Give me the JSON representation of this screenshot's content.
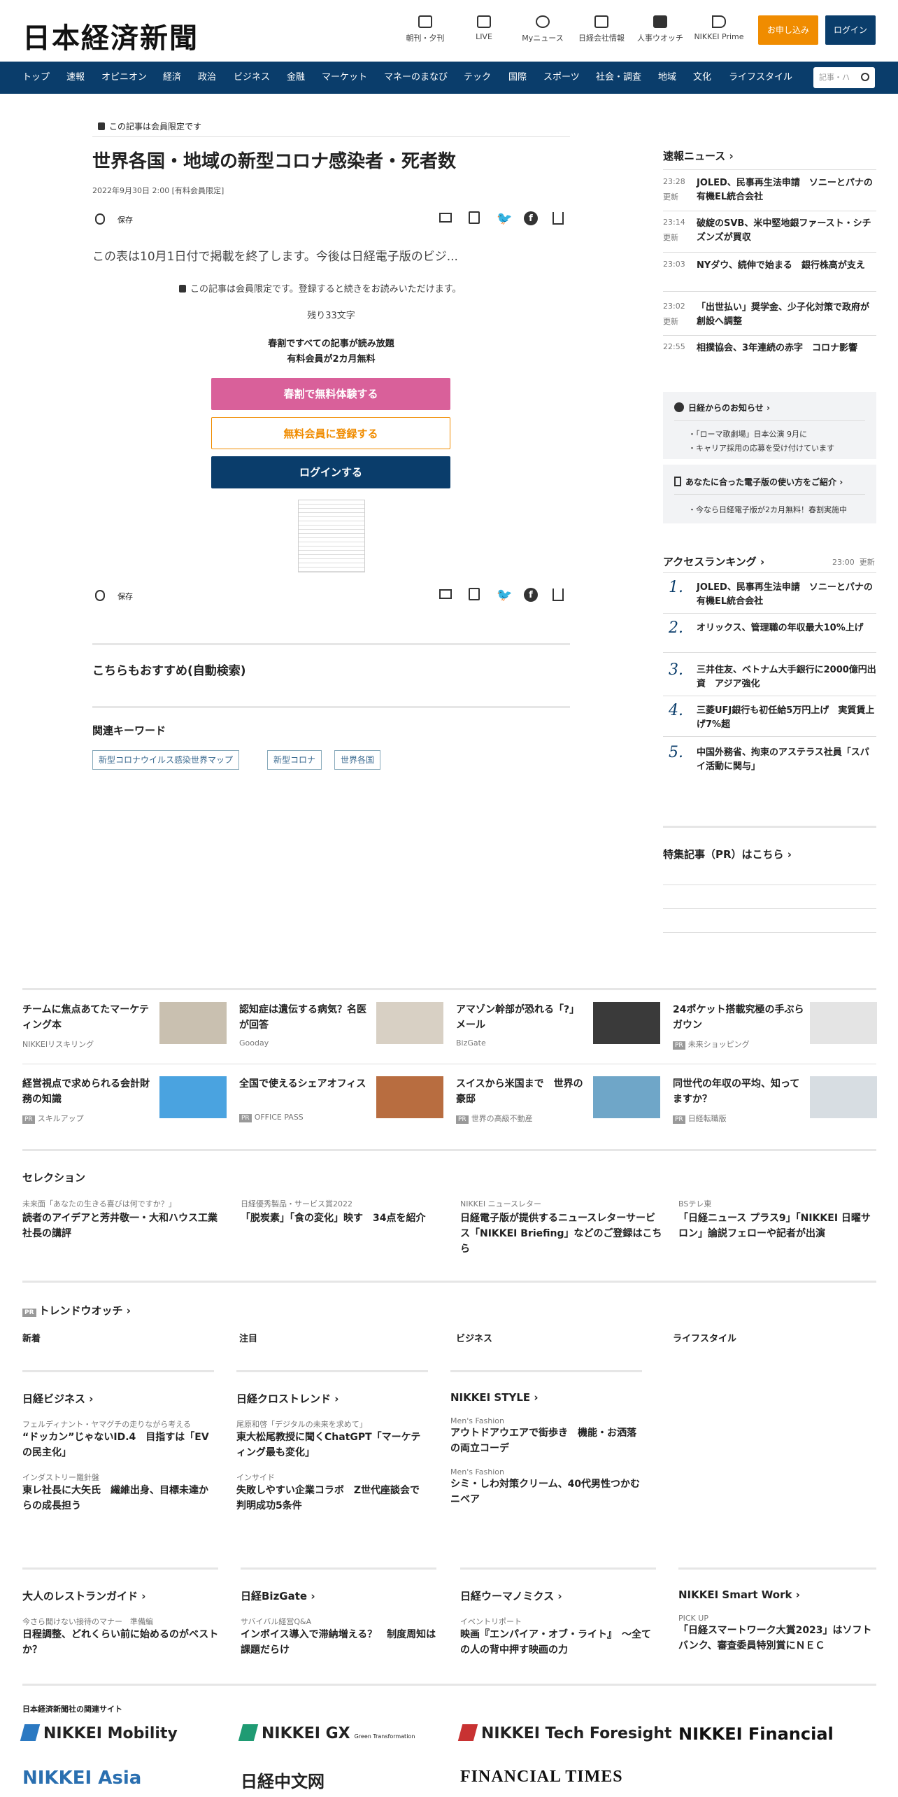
{
  "header": {
    "logo": "日本経済新聞",
    "icons": [
      {
        "label": "朝刊・夕刊",
        "icon": "newspaper-icon"
      },
      {
        "label": "LIVE",
        "icon": "video-icon"
      },
      {
        "label": "Myニュース",
        "icon": "user-icon"
      },
      {
        "label": "日経会社情報",
        "icon": "chart-icon"
      },
      {
        "label": "人事ウオッチ",
        "icon": "search-icon"
      },
      {
        "label": "NIKKEI Prime",
        "icon": "prime-icon"
      }
    ],
    "subscribe": "お申し込み",
    "login": "ログイン"
  },
  "nav": {
    "items": [
      "トップ",
      "速報",
      "オピニオン",
      "経済",
      "政治",
      "ビジネス",
      "金融",
      "マーケット",
      "マネーのまなび",
      "テック",
      "国際",
      "スポーツ",
      "社会・調査",
      "地域",
      "文化",
      "ライフスタイル"
    ],
    "search_placeholder": "記事・ハ"
  },
  "article": {
    "member_only": "この記事は会員限定です",
    "title": "世界各国・地域の新型コロナ感染者・死者数",
    "date": "2022年9月30日 2:00 [有料会員限定]",
    "save": "保存",
    "lead": "この表は10月1日付で掲載を終了します。今後は日経電子版のビジ...",
    "paywall_note": "この記事は会員限定です。登録すると続きをお読みいただけます。",
    "remaining": "残り33文字",
    "promo1": "春割ですべての記事が読み放題",
    "promo2": "有料会員が2カ月無料",
    "cta_trial": "春割で無料体験する",
    "cta_free": "無料会員に登録する",
    "cta_login": "ログインする",
    "recommend": "こちらもおすすめ(自動検索)",
    "keywords_title": "関連キーワード",
    "keywords": [
      "新型コロナウイルス感染世界マップ",
      "新型コロナ",
      "世界各国"
    ]
  },
  "sidebar": {
    "breaking_title": "速報ニュース",
    "breaking": [
      {
        "time": "23:28",
        "upd": "更新",
        "text": "JOLED、民事再生法申請　ソニーとパナの有機EL統合会社"
      },
      {
        "time": "23:14",
        "upd": "更新",
        "text": "破綻のSVB、米中堅地銀ファースト・シチズンズが買収"
      },
      {
        "time": "23:03",
        "upd": "",
        "text": "NYダウ、続伸で始まる　銀行株高が支え"
      },
      {
        "time": "23:02",
        "upd": "更新",
        "text": "「出世払い」奨学金、少子化対策で政府が創設へ調整"
      },
      {
        "time": "22:55",
        "upd": "",
        "text": "相撲協会、3年連続の赤字　コロナ影響"
      }
    ],
    "notice_title": "日経からのお知らせ",
    "notices": [
      "「ローマ歌劇場」日本公演 9月に",
      "キャリア採用の応募を受け付けています"
    ],
    "guide_title": "あなたに合った電子版の使い方をご紹介",
    "guide_items": [
      "今なら日経電子版が2カ月無料！春割実施中"
    ],
    "ranking_title": "アクセスランキング",
    "ranking_time": "23:00",
    "ranking_upd": "更新",
    "ranking": [
      {
        "n": "1.",
        "text": "JOLED、民事再生法申請　ソニーとパナの有機EL統合会社"
      },
      {
        "n": "2.",
        "text": "オリックス、管理職の年収最大10%上げ"
      },
      {
        "n": "3.",
        "text": "三井住友、ベトナム大手銀行に2000億円出資　アジア強化"
      },
      {
        "n": "4.",
        "text": "三菱UFJ銀行も初任給5万円上げ　実質賃上げ7%超"
      },
      {
        "n": "5.",
        "text": "中国外務省、拘束のアステラス社員「スパイ活動に関与」"
      }
    ],
    "pr_title": "特集記事（PR）はこちら"
  },
  "promos": [
    {
      "title": "チームに焦点あてたマーケティング本",
      "src": "NIKKEIリスキリング",
      "pr": false
    },
    {
      "title": "認知症は遺伝する病気？名医が回答",
      "src": "Gooday",
      "pr": false
    },
    {
      "title": "アマゾン幹部が恐れる「?」メール",
      "src": "BizGate",
      "pr": false
    },
    {
      "title": "24ポケット搭載究極の手ぶらガウン",
      "src": "未来ショッピング",
      "pr": true
    },
    {
      "title": "経営視点で求められる会計財務の知識",
      "src": "スキルアップ",
      "pr": true
    },
    {
      "title": "全国で使えるシェアオフィス",
      "src": "OFFICE PASS",
      "pr": true
    },
    {
      "title": "スイスから米国まで　世界の豪邸",
      "src": "世界の高級不動産",
      "pr": true
    },
    {
      "title": "同世代の年収の平均、知ってますか？",
      "src": "日経転職版",
      "pr": true
    }
  ],
  "selection": {
    "title": "セレクション",
    "items": [
      {
        "label": "未来面「あなたの生きる喜びは何ですか？」",
        "text": "読者のアイデアと芳井敬一・大和ハウス工業社長の講評"
      },
      {
        "label": "日経優秀製品・サービス賞2022",
        "text": "「脱炭素」「食の変化」映す　34点を紹介"
      },
      {
        "label": "NIKKEI ニュースレター",
        "text": "日経電子版が提供するニュースレターサービス「NIKKEI Briefing」などのご登録はこちら"
      },
      {
        "label": "BSテレ東",
        "text": "「日経ニュース プラス9」「NIKKEI 日曜サロン」論説フェローや記者が出演"
      }
    ]
  },
  "trend": {
    "title": "トレンドウオッチ",
    "tabs": [
      "新着",
      "注目",
      "ビジネス",
      "ライフスタイル"
    ],
    "cols": [
      {
        "head": "日経ビジネス",
        "items": [
          {
            "label": "フェルディナント・ヤマグチの走りながら考える",
            "text": "“ドッカン”じゃないID.4　目指すは「EVの民主化」"
          },
          {
            "label": "インダストリー羅針盤",
            "text": "東レ社長に大矢氏　繊維出身、目標未達からの成長担う"
          }
        ]
      },
      {
        "head": "日経クロストレンド",
        "items": [
          {
            "label": "尾原和啓「デジタルの未来を求めて」",
            "text": "東大松尾教授に聞くChatGPT「マーケティング最も変化」"
          },
          {
            "label": "インサイド",
            "text": "失敗しやすい企業コラボ　Z世代座談会で判明成功5条件"
          }
        ]
      },
      {
        "head": "NIKKEI STYLE",
        "items": [
          {
            "label": "Men's Fashion",
            "text": "アウトドアウエアで街歩き　機能・お洒落の両立コーデ"
          },
          {
            "label": "Men's Fashion",
            "text": "シミ・しわ対策クリーム、40代男性つかむニベア"
          }
        ]
      }
    ]
  },
  "bottom": [
    {
      "head": "大人のレストランガイド",
      "label": "今さら聞けない接待のマナー　準備編",
      "text": "日程調整、どれくらい前に始めるのがベストか？"
    },
    {
      "head": "日経BizGate",
      "label": "サバイバル経営Q&A",
      "text": "インボイス導入で滞納増える？　制度周知は課題だらけ"
    },
    {
      "head": "日経ウーマノミクス",
      "label": "イベントリポート",
      "text": "映画『エンパイア・オブ・ライト』　～全ての人の背中押す映画の力"
    },
    {
      "head": "NIKKEI Smart Work",
      "label": "PICK UP",
      "text": "「日経スマートワーク大賞2023」はソフトバンク、審査委員特別賞にＮＥＣ"
    }
  ],
  "related": {
    "title": "日本経済新聞社の関連サイト",
    "logos": [
      "NIKKEI Mobility",
      "NIKKEI GX",
      "Green Transformation",
      "NIKKEI Tech Foresight",
      "NIKKEI Financial",
      "NIKKEI Asia",
      "日経中文网",
      "FINANCIAL TIMES"
    ]
  }
}
